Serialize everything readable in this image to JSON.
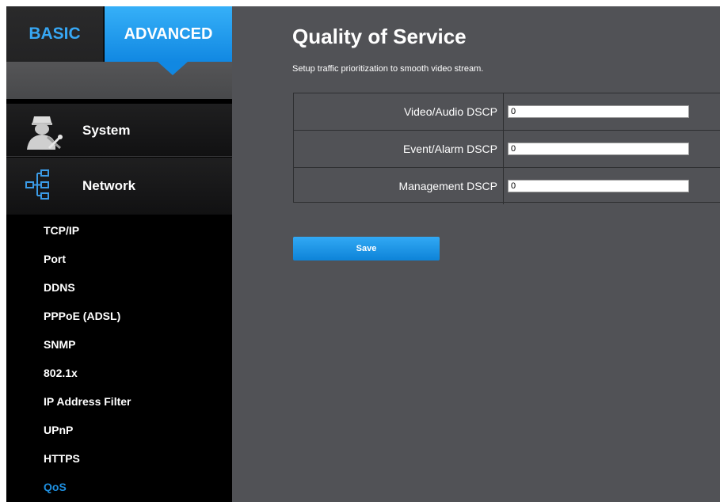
{
  "tabs": {
    "basic": "BASIC",
    "advanced": "ADVANCED"
  },
  "sidebar": {
    "system_label": "System",
    "network_label": "Network",
    "network_items": [
      {
        "label": "TCP/IP"
      },
      {
        "label": "Port"
      },
      {
        "label": "DDNS"
      },
      {
        "label": "PPPoE (ADSL)"
      },
      {
        "label": "SNMP"
      },
      {
        "label": "802.1x"
      },
      {
        "label": "IP Address Filter"
      },
      {
        "label": "UPnP"
      },
      {
        "label": "HTTPS"
      },
      {
        "label": "QoS",
        "active": true
      }
    ],
    "icons": {
      "system": "technician-settings-icon",
      "network": "network-tree-icon"
    }
  },
  "page": {
    "title": "Quality of Service",
    "subtitle": "Setup traffic prioritization to smooth video stream."
  },
  "qos_fields": [
    {
      "label": "Video/Audio DSCP",
      "value": "0"
    },
    {
      "label": "Event/Alarm DSCP",
      "value": "0"
    },
    {
      "label": "Management DSCP",
      "value": "0"
    }
  ],
  "save_label": "Save",
  "colors": {
    "accent": "#1e8fe0",
    "tab_active": "#1e95ee",
    "tab_inactive_text": "#37a7f4",
    "content_bg": "#515256",
    "sidebar_bg": "#000000"
  }
}
